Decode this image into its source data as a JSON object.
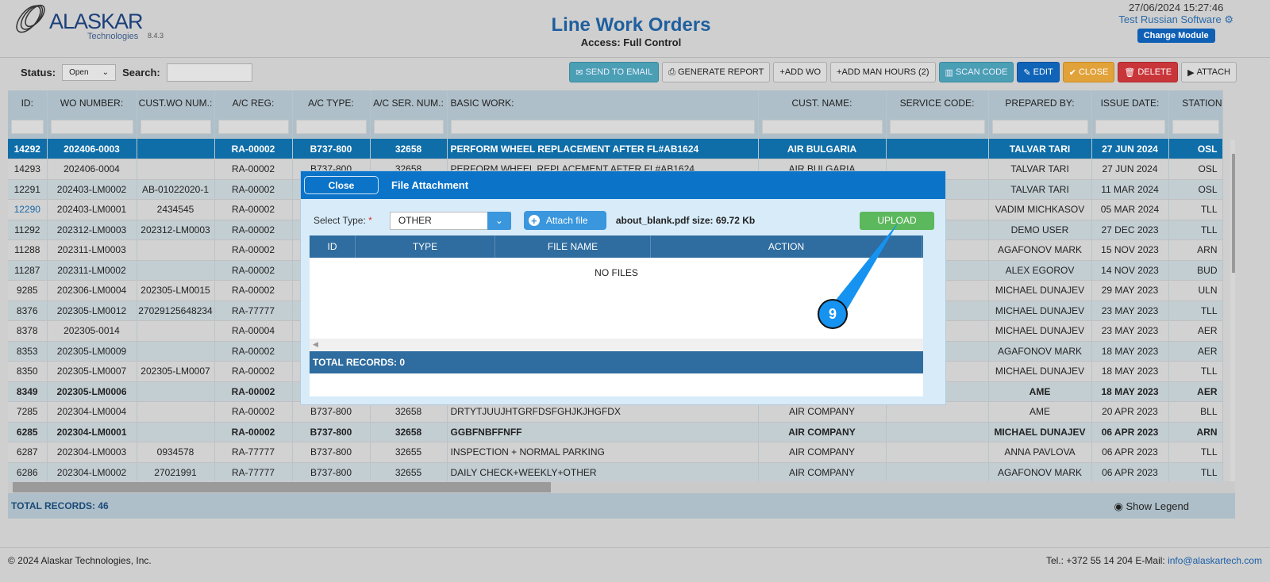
{
  "header": {
    "logo_name": "ALASKAR",
    "logo_sub": "Technologies",
    "version": "8.4.3",
    "title": "Line Work Orders",
    "access": "Access: Full Control",
    "datetime": "27/06/2024 15:27:46",
    "company": "Test Russian Software",
    "change_module": "Change Module"
  },
  "filters": {
    "status_label": "Status:",
    "status_value": "Open",
    "search_label": "Search:",
    "search_value": ""
  },
  "toolbar": [
    "SEND TO EMAIL",
    "GENERATE REPORT",
    "ADD WO",
    "ADD MAN HOURS (2)",
    "SCAN CODE",
    "EDIT",
    "CLOSE",
    "DELETE",
    "ATTACH"
  ],
  "table": {
    "columns": [
      "ID:",
      "WO NUMBER:",
      "CUST.WO NUM.:",
      "A/C REG:",
      "A/C TYPE:",
      "A/C SER. NUM.:",
      "BASIC WORK:",
      "CUST. NAME:",
      "SERVICE CODE:",
      "PREPARED BY:",
      "ISSUE DATE:",
      "STATION"
    ],
    "rows": [
      [
        "14292",
        "202406-0003",
        "",
        "RA-00002",
        "B737-800",
        "32658",
        "PERFORM WHEEL REPLACEMENT AFTER FL#AB1624",
        "AIR BULGARIA",
        "",
        "TALVAR TARI",
        "27 JUN 2024",
        "OSL"
      ],
      [
        "14293",
        "202406-0004",
        "",
        "RA-00002",
        "B737-800",
        "32658",
        "PERFORM WHEEL REPLACEMENT AFTER FL#AB1624",
        "AIR BULGARIA",
        "",
        "TALVAR TARI",
        "27 JUN 2024",
        "OSL"
      ],
      [
        "12291",
        "202403-LM0002",
        "AB-01022020-1",
        "RA-00002",
        "",
        "",
        "",
        "",
        "",
        "TALVAR TARI",
        "11 MAR 2024",
        "OSL"
      ],
      [
        "12290",
        "202403-LM0001",
        "2434545",
        "RA-00002",
        "",
        "",
        "",
        "",
        "",
        "VADIM MICHKASOV",
        "05 MAR 2024",
        "TLL"
      ],
      [
        "11292",
        "202312-LM0003",
        "202312-LM0003",
        "RA-00002",
        "",
        "",
        "",
        "",
        "",
        "DEMO USER",
        "27 DEC 2023",
        "TLL"
      ],
      [
        "11288",
        "202311-LM0003",
        "",
        "RA-00002",
        "",
        "",
        "",
        "",
        "",
        "AGAFONOV MARK",
        "15 NOV 2023",
        "ARN"
      ],
      [
        "11287",
        "202311-LM0002",
        "",
        "RA-00002",
        "",
        "",
        "",
        "",
        "",
        "ALEX EGOROV",
        "14 NOV 2023",
        "BUD"
      ],
      [
        "9285",
        "202306-LM0004",
        "202305-LM0015",
        "RA-00002",
        "",
        "",
        "",
        "",
        "",
        "MICHAEL DUNAJEV",
        "29 MAY 2023",
        "ULN"
      ],
      [
        "8376",
        "202305-LM0012",
        "27029125648234",
        "RA-77777",
        "",
        "",
        "",
        "",
        "",
        "MICHAEL DUNAJEV",
        "23 MAY 2023",
        "TLL"
      ],
      [
        "8378",
        "202305-0014",
        "",
        "RA-00004",
        "",
        "",
        "",
        "",
        "",
        "MICHAEL DUNAJEV",
        "23 MAY 2023",
        "AER"
      ],
      [
        "8353",
        "202305-LM0009",
        "",
        "RA-00002",
        "",
        "",
        "",
        "",
        "",
        "AGAFONOV MARK",
        "18 MAY 2023",
        "AER"
      ],
      [
        "8350",
        "202305-LM0007",
        "202305-LM0007",
        "RA-00002",
        "",
        "",
        "",
        "",
        "",
        "MICHAEL DUNAJEV",
        "18 MAY 2023",
        "TLL"
      ],
      [
        "8349",
        "202305-LM0006",
        "",
        "RA-00002",
        "",
        "",
        "",
        "",
        "",
        "AME",
        "18 MAY 2023",
        "AER"
      ],
      [
        "7285",
        "202304-LM0004",
        "",
        "RA-00002",
        "B737-800",
        "32658",
        "DRTYTJUUJHTGRFDSFGHJKJHGFDX",
        "AIR COMPANY",
        "",
        "AME",
        "20 APR 2023",
        "BLL"
      ],
      [
        "6285",
        "202304-LM0001",
        "",
        "RA-00002",
        "B737-800",
        "32658",
        "GGBFNBFFNFF",
        "AIR COMPANY",
        "",
        "MICHAEL DUNAJEV",
        "06 APR 2023",
        "ARN"
      ],
      [
        "6287",
        "202304-LM0003",
        "0934578",
        "RA-77777",
        "B737-800",
        "32655",
        "INSPECTION + NORMAL PARKING",
        "AIR COMPANY",
        "",
        "ANNA PAVLOVA",
        "06 APR 2023",
        "TLL"
      ],
      [
        "6286",
        "202304-LM0002",
        "27021991",
        "RA-77777",
        "B737-800",
        "32655",
        "DAILY CHECK+WEEKLY+OTHER",
        "AIR COMPANY",
        "",
        "AGAFONOV MARK",
        "06 APR 2023",
        "TLL"
      ]
    ],
    "selected_row": 0,
    "bold_rows": [
      12,
      14
    ],
    "total": "TOTAL RECORDS: 46",
    "show_legend": "Show Legend"
  },
  "modal": {
    "close": "Close",
    "title": "File Attachment",
    "select_type_label": "Select Type:",
    "required_mark": "*",
    "select_type_value": "OTHER",
    "attach_file": "Attach file",
    "file_info": "about_blank.pdf size: 69.72 Kb",
    "upload": "UPLOAD",
    "columns": [
      "ID",
      "TYPE",
      "FILE NAME",
      "ACTION"
    ],
    "empty": "NO FILES",
    "total": "TOTAL RECORDS: 0"
  },
  "annotation": {
    "step": "9"
  },
  "footer": {
    "copyright": "© 2024 Alaskar Technologies, Inc.",
    "contact": "Tel.: +372 55 14 204 E-Mail:",
    "email": "info@alaskartech.com"
  }
}
